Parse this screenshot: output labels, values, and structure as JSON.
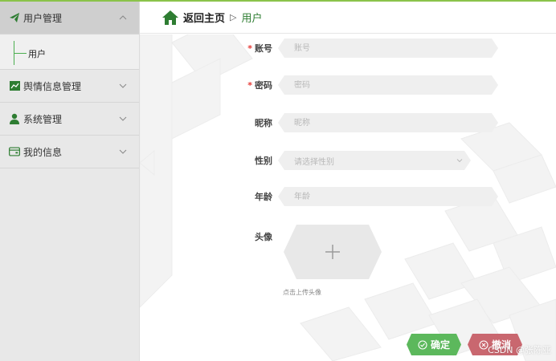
{
  "colors": {
    "accent_green": "#2e7d32",
    "top_line": "#8bc34a",
    "required_star": "#e53935",
    "confirm_button": "#5cb85c",
    "cancel_button": "#c9676f"
  },
  "sidebar": {
    "menus": [
      {
        "label": "用户管理",
        "icon": "paper-plane-icon",
        "active": true,
        "expanded": true,
        "children": [
          {
            "label": "用户"
          }
        ]
      },
      {
        "label": "舆情信息管理",
        "icon": "chart-line-icon",
        "active": false,
        "expanded": false
      },
      {
        "label": "系统管理",
        "icon": "user-icon",
        "active": false,
        "expanded": false
      },
      {
        "label": "我的信息",
        "icon": "card-icon",
        "active": false,
        "expanded": false
      }
    ]
  },
  "header": {
    "home_icon": "home-icon",
    "home_label": "返回主页",
    "separator": "▷",
    "current": "用户"
  },
  "form": {
    "account": {
      "label": "账号",
      "placeholder": "账号",
      "required": true
    },
    "password": {
      "label": "密码",
      "placeholder": "密码",
      "required": true
    },
    "nickname": {
      "label": "昵称",
      "placeholder": "昵称",
      "required": false
    },
    "gender": {
      "label": "性别",
      "placeholder": "请选择性别",
      "required": false
    },
    "age": {
      "label": "年龄",
      "placeholder": "年龄",
      "required": false
    },
    "avatar": {
      "label": "头像",
      "hint": "点击上传头像"
    }
  },
  "buttons": {
    "confirm": "确定",
    "cancel": "撤消"
  },
  "watermark": "CSDN @张陈亚"
}
